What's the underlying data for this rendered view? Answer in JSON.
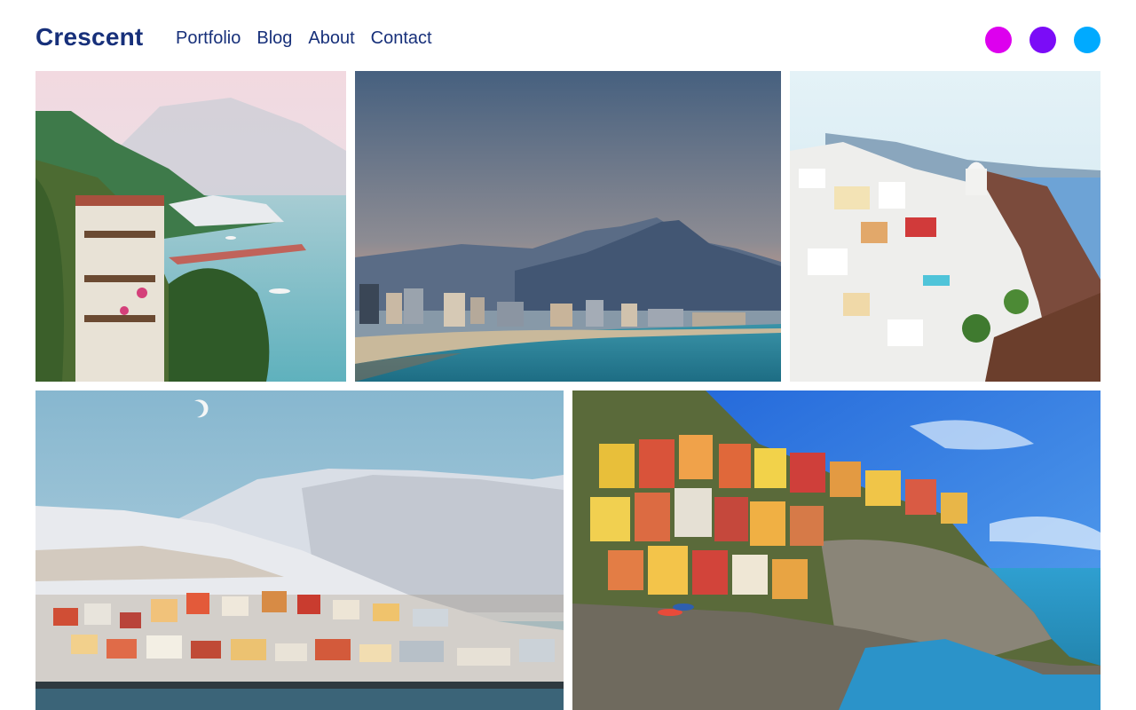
{
  "brand": {
    "name": "Crescent"
  },
  "nav": {
    "items": [
      {
        "label": "Portfolio"
      },
      {
        "label": "Blog"
      },
      {
        "label": "About"
      },
      {
        "label": "Contact"
      }
    ]
  },
  "theme_swatches": [
    {
      "color": "#dd00ee"
    },
    {
      "color": "#7b0cf7"
    },
    {
      "color": "#00aaff"
    }
  ],
  "gallery": {
    "photos": [
      {
        "subject": "coastal cliffside town with sea and harbor"
      },
      {
        "subject": "city beach skyline with mountains at dusk"
      },
      {
        "subject": "white cliffside village above the sea"
      },
      {
        "subject": "snowy hillside with colorful harbor town"
      },
      {
        "subject": "colorful cliffside village over blue sea"
      }
    ]
  }
}
